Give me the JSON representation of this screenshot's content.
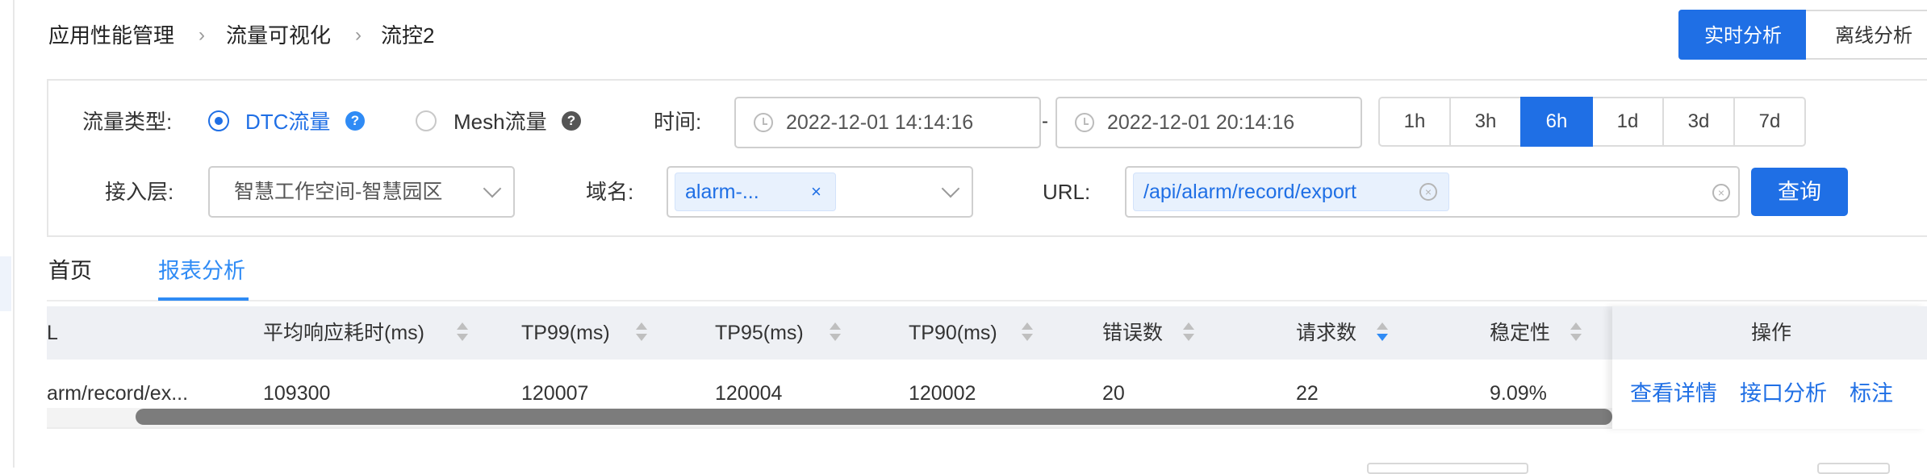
{
  "breadcrumb": [
    "应用性能管理",
    "流量可视化",
    "流控2"
  ],
  "mode": {
    "realtime_label": "实时分析",
    "offline_label": "离线分析"
  },
  "filters": {
    "traffic_type_label": "流量类型:",
    "traffic_options": [
      {
        "label": "DTC流量",
        "selected": true
      },
      {
        "label": "Mesh流量",
        "selected": false
      }
    ],
    "time_label": "时间:",
    "time_start": "2022-12-01 14:14:16",
    "time_sep": "-",
    "time_end": "2022-12-01 20:14:16",
    "ranges": [
      "1h",
      "3h",
      "6h",
      "1d",
      "3d",
      "7d"
    ],
    "active_range": "6h",
    "access_layer_label": "接入层:",
    "access_layer_value": "智慧工作空间-智慧园区",
    "domain_label": "域名:",
    "domain_tag": "alarm-...",
    "url_label": "URL:",
    "url_tag": "/api/alarm/record/export",
    "query_label": "查询"
  },
  "tabs": [
    {
      "label": "首页",
      "active": false
    },
    {
      "label": "报表分析",
      "active": true
    }
  ],
  "table": {
    "columns": [
      "L",
      "平均响应耗时(ms)",
      "TP99(ms)",
      "TP95(ms)",
      "TP90(ms)",
      "错误数",
      "请求数",
      "稳定性",
      "操作"
    ],
    "sorted_column": "请求数",
    "rows": [
      {
        "url": "arm/record/ex...",
        "avg": "109300",
        "tp99": "120007",
        "tp95": "120004",
        "tp90": "120002",
        "errors": "20",
        "requests": "22",
        "stability": "9.09%",
        "actions": [
          "查看详情",
          "接口分析",
          "标注"
        ]
      }
    ]
  },
  "colors": {
    "primary": "#1f6fe5",
    "tab_active": "#2f8bf5",
    "header_bg": "#eef0f4"
  }
}
